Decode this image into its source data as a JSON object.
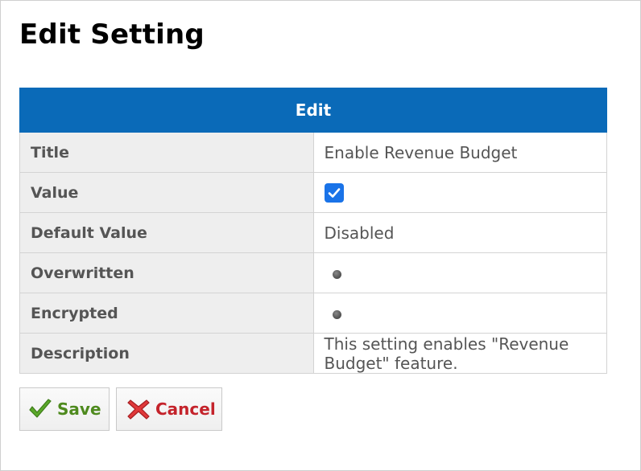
{
  "page": {
    "title": "Edit Setting"
  },
  "table": {
    "header": "Edit",
    "rows": [
      {
        "label": "Title",
        "value": "Enable Revenue Budget"
      },
      {
        "label": "Value",
        "value_checked": true
      },
      {
        "label": "Default Value",
        "value": "Disabled"
      },
      {
        "label": "Overwritten",
        "value_indicator": "dot-icon"
      },
      {
        "label": "Encrypted",
        "value_indicator": "dot-icon"
      },
      {
        "label": "Description",
        "value": "This setting enables \"Revenue Budget\" feature."
      }
    ]
  },
  "buttons": {
    "save_label": "Save",
    "save_icon": "checkmark-icon",
    "cancel_label": "Cancel",
    "cancel_icon": "x-icon"
  },
  "colors": {
    "header_bg": "#0a6ab8",
    "checkbox": "#1a73e8",
    "save": "#4e8a1e",
    "cancel": "#c4232b"
  }
}
